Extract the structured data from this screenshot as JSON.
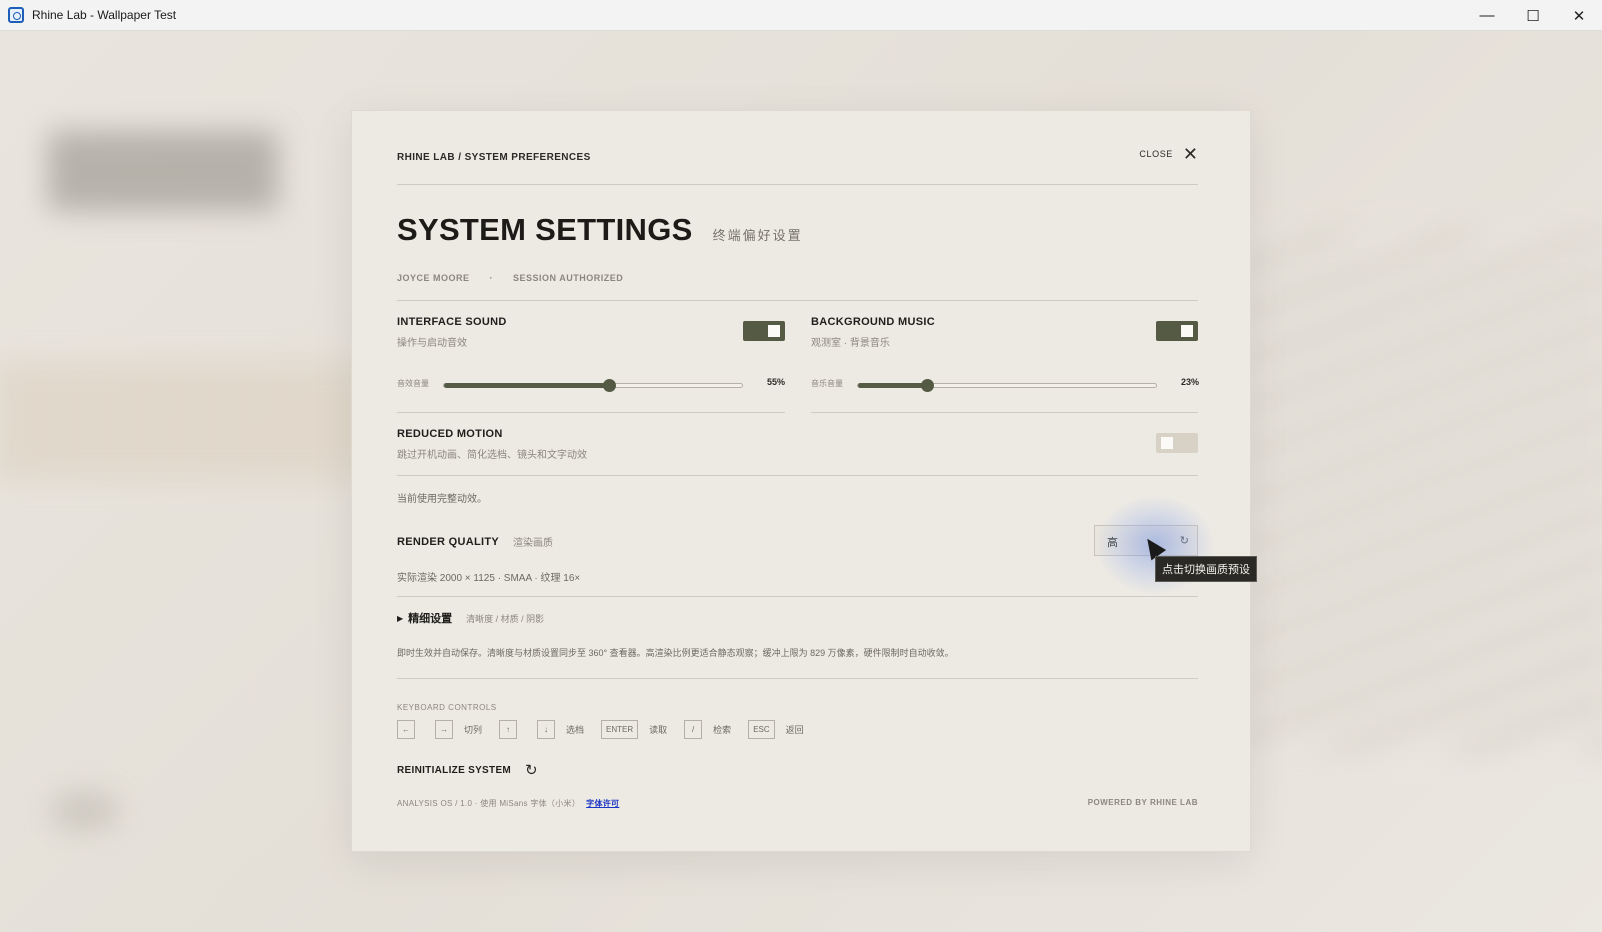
{
  "window": {
    "title": "Rhine Lab - Wallpaper Test",
    "minimize_glyph": "—",
    "maximize_glyph": "☐",
    "close_glyph": "✕"
  },
  "panel": {
    "breadcrumb": "RHINE LAB / SYSTEM PREFERENCES",
    "close_label": "CLOSE",
    "close_glyph": "✕",
    "title": "SYSTEM SETTINGS",
    "subtitle": "终端偏好设置",
    "user": "JOYCE MOORE",
    "separator": "·",
    "session": "SESSION AUTHORIZED"
  },
  "interface_sound": {
    "title": "INTERFACE SOUND",
    "subtitle": "操作与启动音效",
    "enabled": true,
    "slider_label": "音效音量",
    "volume_percent": 55,
    "value_text": "55%"
  },
  "background_music": {
    "title": "BACKGROUND MUSIC",
    "subtitle": "观测室 · 背景音乐",
    "enabled": true,
    "slider_label": "音乐音量",
    "volume_percent": 23,
    "value_text": "23%"
  },
  "reduced_motion": {
    "title": "REDUCED MOTION",
    "subtitle": "跳过开机动画、简化选档、镜头和文字动效",
    "enabled": false,
    "status": "当前使用完整动效。"
  },
  "render_quality": {
    "title": "RENDER QUALITY",
    "subtitle": "渲染画质",
    "value": "高",
    "refresh_glyph": "↻",
    "detail": "实际渲染 2000 × 1125 · SMAA · 纹理 16×",
    "tooltip": "点击切换画质预设"
  },
  "fine_settings": {
    "triangle": "▶",
    "label": "精细设置",
    "subtitle": "清晰度 / 材质 / 阴影",
    "note": "即时生效并自动保存。清晰度与材质设置同步至 360° 查看器。高渲染比例更适合静态观察；缓冲上限为 829 万像素，硬件限制时自动收敛。"
  },
  "keyboard": {
    "title": "KEYBOARD CONTROLS",
    "left_key": "←",
    "right_key": "→",
    "lr_label": "切列",
    "up_key": "↑",
    "down_key": "↓",
    "ud_label": "选档",
    "enter_key": "ENTER",
    "enter_label": "读取",
    "slash_key": "/",
    "slash_label": "检索",
    "esc_key": "ESC",
    "esc_label": "返回"
  },
  "reinitialize": {
    "label": "REINITIALIZE SYSTEM",
    "icon_glyph": "↻"
  },
  "footer": {
    "left": "ANALYSIS OS / 1.0 · 使用 MiSans 字体（小米）",
    "link": "字体许可",
    "right": "POWERED BY RHINE LAB"
  },
  "colors": {
    "accent": "#555a45",
    "panel": "#edeae4",
    "toggle_off": "#d8d1c6"
  }
}
